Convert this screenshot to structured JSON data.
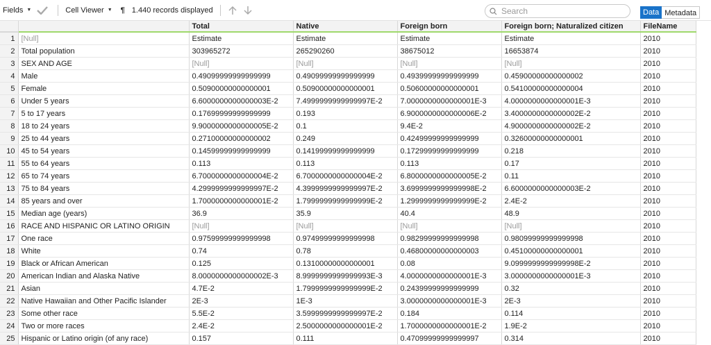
{
  "toolbar": {
    "fields_label": "Fields",
    "cell_viewer_label": "Cell Viewer",
    "pilcrow": "¶",
    "records_label": "1.440 records displayed",
    "search_placeholder": "Search",
    "tab_data": "Data",
    "tab_metadata": "Metadata"
  },
  "table": {
    "columns": [
      "",
      "Total",
      "Native",
      "Foreign born",
      "Foreign born; Naturalized citizen",
      "FileName"
    ],
    "rows": [
      [
        "1",
        "[Null]",
        "Estimate",
        "Estimate",
        "Estimate",
        "Estimate",
        "2010"
      ],
      [
        "2",
        "Total population",
        "303965272",
        "265290260",
        "38675012",
        "16653874",
        "2010"
      ],
      [
        "3",
        "SEX AND AGE",
        "[Null]",
        "[Null]",
        "[Null]",
        "[Null]",
        "2010"
      ],
      [
        "4",
        "Male",
        "0.49099999999999999",
        "0.49099999999999999",
        "0.49399999999999999",
        "0.45900000000000002",
        "2010"
      ],
      [
        "5",
        "Female",
        "0.50900000000000001",
        "0.50900000000000001",
        "0.50600000000000001",
        "0.54100000000000004",
        "2010"
      ],
      [
        "6",
        "Under 5 years",
        "6.6000000000000003E-2",
        "7.4999999999999997E-2",
        "7.0000000000000001E-3",
        "4.0000000000000001E-3",
        "2010"
      ],
      [
        "7",
        "5 to 17 years",
        "0.17699999999999999",
        "0.193",
        "6.9000000000000006E-2",
        "3.4000000000000002E-2",
        "2010"
      ],
      [
        "8",
        "18 to 24 years",
        "9.9000000000000005E-2",
        "0.1",
        "9.4E-2",
        "4.9000000000000002E-2",
        "2010"
      ],
      [
        "9",
        "25 to 44 years",
        "0.27100000000000002",
        "0.249",
        "0.42499999999999999",
        "0.32600000000000001",
        "2010"
      ],
      [
        "10",
        "45 to 54 years",
        "0.14599999999999999",
        "0.14199999999999999",
        "0.17299999999999999",
        "0.218",
        "2010"
      ],
      [
        "11",
        "55 to 64 years",
        "0.113",
        "0.113",
        "0.113",
        "0.17",
        "2010"
      ],
      [
        "12",
        "65 to 74 years",
        "6.7000000000000004E-2",
        "6.7000000000000004E-2",
        "6.8000000000000005E-2",
        "0.11",
        "2010"
      ],
      [
        "13",
        "75 to 84 years",
        "4.2999999999999997E-2",
        "4.3999999999999997E-2",
        "3.6999999999999998E-2",
        "6.6000000000000003E-2",
        "2010"
      ],
      [
        "14",
        "85 years and over",
        "1.7000000000000001E-2",
        "1.7999999999999999E-2",
        "1.2999999999999999E-2",
        "2.4E-2",
        "2010"
      ],
      [
        "15",
        "Median age (years)",
        "36.9",
        "35.9",
        "40.4",
        "48.9",
        "2010"
      ],
      [
        "16",
        "RACE AND HISPANIC OR LATINO ORIGIN",
        "[Null]",
        "[Null]",
        "[Null]",
        "[Null]",
        "2010"
      ],
      [
        "17",
        "One race",
        "0.97599999999999998",
        "0.97499999999999998",
        "0.98299999999999998",
        "0.98099999999999998",
        "2010"
      ],
      [
        "18",
        "White",
        "0.74",
        "0.78",
        "0.46800000000000003",
        "0.45100000000000001",
        "2010"
      ],
      [
        "19",
        "Black or African American",
        "0.125",
        "0.13100000000000001",
        "0.08",
        "9.0999999999999998E-2",
        "2010"
      ],
      [
        "20",
        "American Indian and Alaska Native",
        "8.0000000000000002E-3",
        "8.9999999999999993E-3",
        "4.0000000000000001E-3",
        "3.0000000000000001E-3",
        "2010"
      ],
      [
        "21",
        "Asian",
        "4.7E-2",
        "1.7999999999999999E-2",
        "0.24399999999999999",
        "0.32",
        "2010"
      ],
      [
        "22",
        "Native Hawaiian and Other Pacific Islander",
        "2E-3",
        "1E-3",
        "3.0000000000000001E-3",
        "2E-3",
        "2010"
      ],
      [
        "23",
        "Some other race",
        "5.5E-2",
        "3.5999999999999997E-2",
        "0.184",
        "0.114",
        "2010"
      ],
      [
        "24",
        "Two or more races",
        "2.4E-2",
        "2.5000000000000001E-2",
        "1.7000000000000001E-2",
        "1.9E-2",
        "2010"
      ],
      [
        "25",
        "Hispanic or Latino origin (of any race)",
        "0.157",
        "0.111",
        "0.47099999999999997",
        "0.314",
        "2010"
      ]
    ]
  }
}
